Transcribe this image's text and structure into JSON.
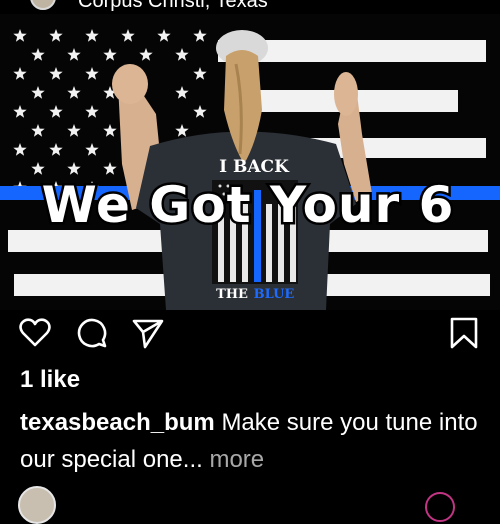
{
  "post": {
    "location": "Corpus Christi, Texas",
    "image": {
      "overlay_text": "We Got Your 6",
      "shirt_top": "I BACK",
      "shirt_bottom_left": "THE",
      "shirt_bottom_right": "BLUE",
      "colors": {
        "flag_white": "#f2f2f2",
        "flag_black": "#000000",
        "thin_blue_line": "#1565ff"
      }
    },
    "actions": {
      "like_icon": "heart-icon",
      "comment_icon": "comment-icon",
      "share_icon": "paper-plane-icon",
      "save_icon": "bookmark-icon"
    },
    "likes": "1 like",
    "caption": {
      "username": "texasbeach_bum",
      "text": "Make sure you tune into our special one",
      "ellipsis": "...",
      "more": "more"
    }
  }
}
